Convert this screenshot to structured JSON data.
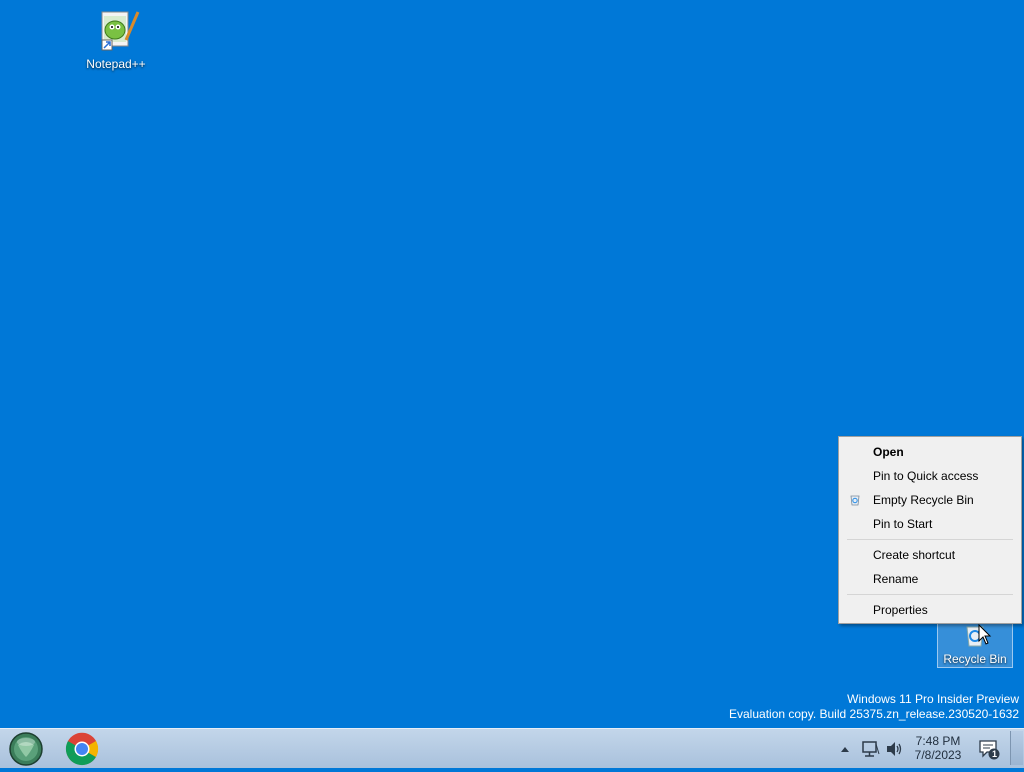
{
  "desktop": {
    "background_color": "#0078d7",
    "icons": [
      {
        "label": "Notepad++",
        "icon": "notepad-plus-plus-icon"
      },
      {
        "label": "Recycle Bin",
        "icon": "recycle-bin-icon"
      }
    ]
  },
  "context_menu": {
    "items": [
      {
        "label": "Open",
        "bold": true
      },
      {
        "label": "Pin to Quick access"
      },
      {
        "label": "Empty Recycle Bin",
        "icon": "recycle-bin-icon"
      },
      {
        "label": "Pin to Start"
      },
      {
        "label": "Create shortcut"
      },
      {
        "label": "Rename"
      },
      {
        "label": "Properties"
      }
    ]
  },
  "watermark": {
    "line1": "Windows 11 Pro Insider Preview",
    "line2": "Evaluation copy. Build 25375.zn_release.230520-1632"
  },
  "taskbar": {
    "start_icon": "start-orb-icon",
    "pinned": [
      {
        "name": "Google Chrome",
        "icon": "chrome-icon"
      }
    ],
    "tray": {
      "icons": [
        "show-hidden-icons-chevron-icon",
        "network-icon",
        "volume-icon"
      ],
      "time": "7:48 PM",
      "date": "7/8/2023",
      "notification_count": "1"
    }
  }
}
